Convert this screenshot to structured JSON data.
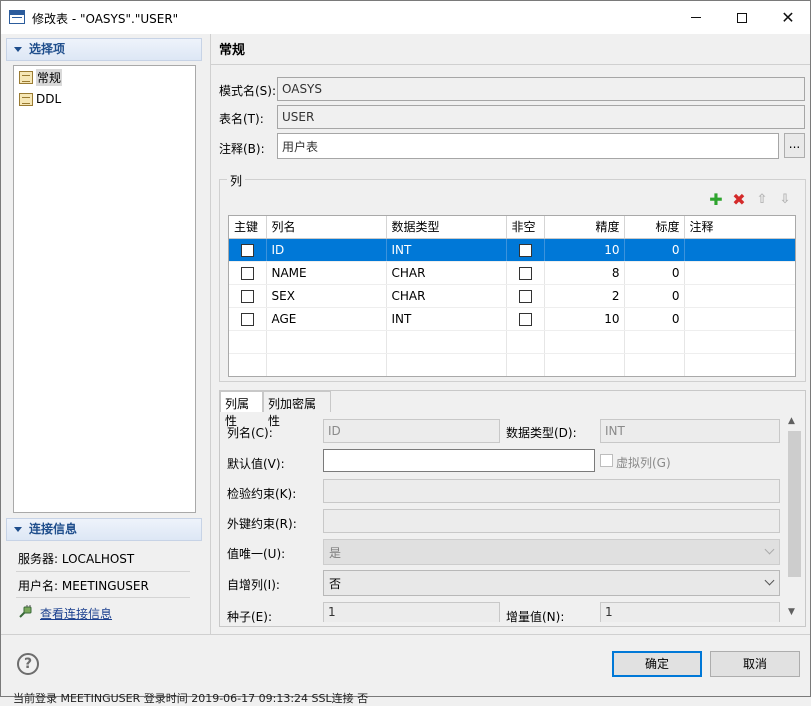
{
  "window": {
    "title": "修改表 - \"OASYS\".\"USER\""
  },
  "left": {
    "options_header": "选择项",
    "tree": [
      {
        "label": "常规",
        "selected": true
      },
      {
        "label": "DDL",
        "selected": false
      }
    ],
    "conn_header": "连接信息",
    "server": "服务器: LOCALHOST",
    "user": "用户名: MEETINGUSER",
    "view_link": "查看连接信息"
  },
  "main": {
    "title": "常规",
    "schema_label": "模式名(S):",
    "schema_value": "OASYS",
    "table_label": "表名(T):",
    "table_value": "USER",
    "comment_label": "注释(B):",
    "comment_value": "用户表",
    "more_button": "...",
    "columns_group": "列",
    "grid_headers": [
      "主键",
      "列名",
      "数据类型",
      "非空",
      "精度",
      "标度",
      "注释"
    ],
    "rows": [
      {
        "name": "ID",
        "type": "INT",
        "precision": "10",
        "scale": "0"
      },
      {
        "name": "NAME",
        "type": "CHAR",
        "precision": "8",
        "scale": "0"
      },
      {
        "name": "SEX",
        "type": "CHAR",
        "precision": "2",
        "scale": "0"
      },
      {
        "name": "AGE",
        "type": "INT",
        "precision": "10",
        "scale": "0"
      }
    ]
  },
  "props": {
    "tab_props": "列属性",
    "tab_encrypt": "列加密属性",
    "col_name_label": "列名(C):",
    "col_name_value": "ID",
    "data_type_label": "数据类型(D):",
    "data_type_value": "INT",
    "default_label": "默认值(V):",
    "virtual_label": "虚拟列(G)",
    "check_label": "检验约束(K):",
    "fk_label": "外键约束(R):",
    "unique_label": "值唯一(U):",
    "unique_value": "是",
    "identity_label": "自增列(I):",
    "identity_value": "否",
    "seed_label": "种子(E):",
    "seed_value": "1",
    "increment_label": "增量值(N):",
    "increment_value": "1"
  },
  "footer": {
    "ok": "确定",
    "cancel": "取消",
    "status_bleed": "当前登录 MEETINGUSER      登录时间 2019-06-17 09:13:24      SSL连接 否"
  },
  "colors": {
    "accent": "#0078d7",
    "header_text": "#1f4e8c",
    "link": "#1a3f8e"
  }
}
